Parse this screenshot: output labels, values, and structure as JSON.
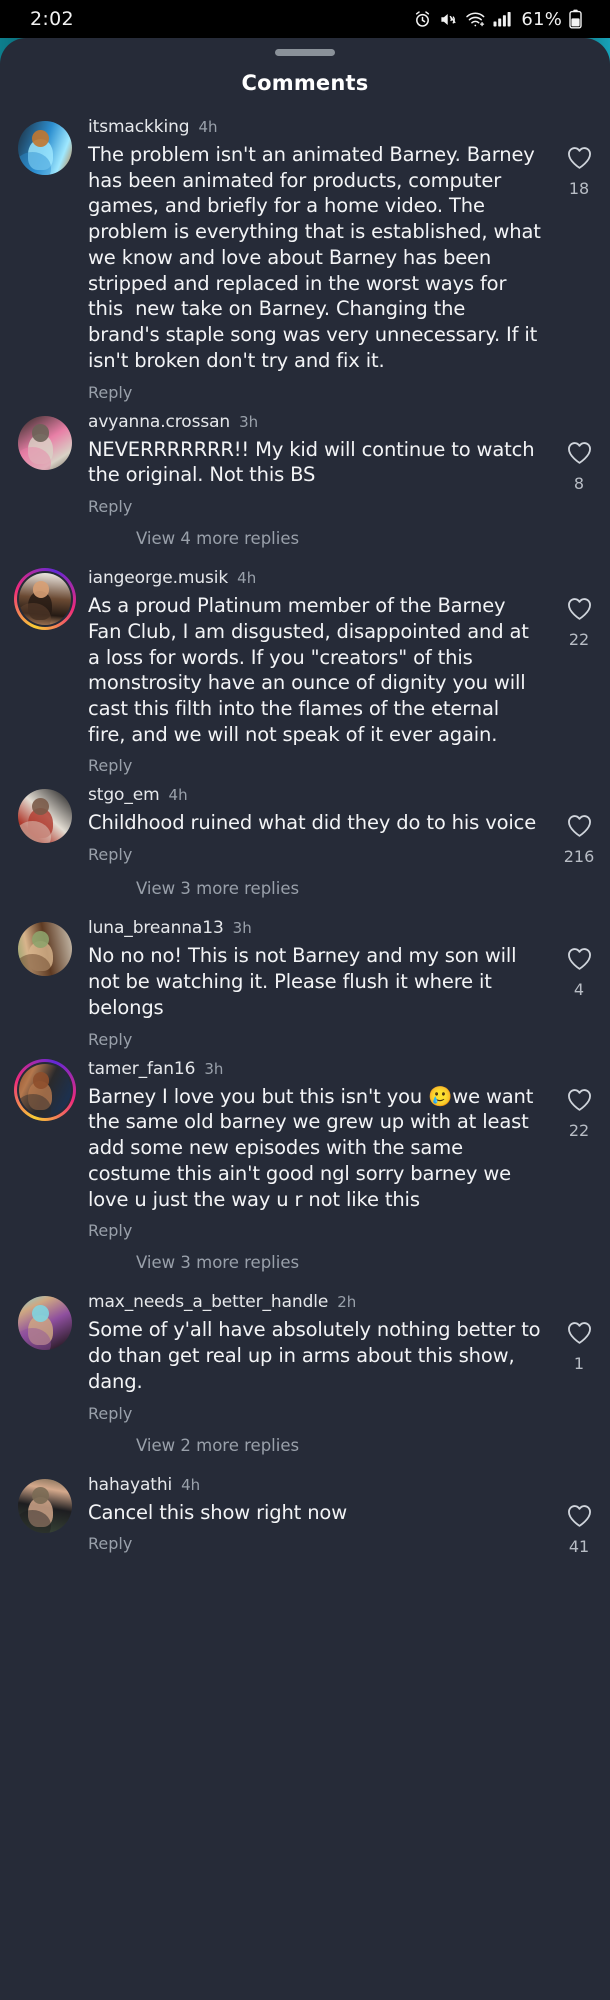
{
  "statusbar": {
    "time": "2:02",
    "battery_text": "61%",
    "icons": [
      "alarm-icon",
      "mute-icon",
      "wifi-icon",
      "cellular-signal-icon",
      "battery-icon"
    ]
  },
  "sheet": {
    "title": "Comments",
    "grabber": "drag-handle",
    "background_color": "#262b38"
  },
  "labels": {
    "reply": "Reply"
  },
  "comments": [
    {
      "username": "itsmackking",
      "timestamp": "4h",
      "text": "The problem isn't an animated Barney. Barney has been animated for products, computer games, and briefly for a home video. The problem is everything that is established, what we know and love about Barney has been stripped and replaced in the worst ways for this  new take on Barney. Changing the brand's staple song was very unnecessary. If it isn't broken don't try and fix it.",
      "reply_label": "Reply",
      "likes": "18",
      "has_story_ring": false,
      "view_replies": null,
      "avatar_colors": [
        "#1b2b3a",
        "#2d8fd0",
        "#9fe8ff",
        "#c2772f"
      ]
    },
    {
      "username": "avyanna.crossan",
      "timestamp": "3h",
      "text": "NEVERRRRRRR!! My kid will continue to watch the original. Not this BS",
      "reply_label": "Reply",
      "likes": "8",
      "has_story_ring": false,
      "view_replies": "View 4 more replies",
      "avatar_colors": [
        "#2a2621",
        "#e87fa6",
        "#d9d2c6",
        "#6b6358"
      ]
    },
    {
      "username": "iangeorge.musik",
      "timestamp": "4h",
      "text": "As a proud Platinum member of the Barney Fan Club, I am disgusted, disappointed and at a loss for words. If you \"creators\" of this monstrosity have an ounce of dignity you will cast this filth into the flames of the eternal fire, and we will not speak of it ever again.",
      "reply_label": "Reply",
      "likes": "22",
      "has_story_ring": true,
      "view_replies": null,
      "avatar_colors": [
        "#f5f2ee",
        "#6b4a33",
        "#241a14",
        "#d8a074"
      ]
    },
    {
      "username": "stgo_em",
      "timestamp": "4h",
      "text": "Childhood ruined what did they do to his voice",
      "reply_label": "Reply",
      "likes": "216",
      "has_story_ring": false,
      "view_replies": "View 3 more replies",
      "avatar_colors": [
        "#0d0d0f",
        "#e3ddd3",
        "#b03a2e",
        "#7a5a48"
      ]
    },
    {
      "username": "luna_breanna13",
      "timestamp": "3h",
      "text": "No no no! This is not Barney and my son will not be watching it. Please flush it where it belongs",
      "reply_label": "Reply",
      "likes": "4",
      "has_story_ring": false,
      "view_replies": null,
      "avatar_colors": [
        "#cfc6b6",
        "#5e3a22",
        "#d8b48c",
        "#8ea36b"
      ]
    },
    {
      "username": "tamer_fan16",
      "timestamp": "3h",
      "text": "Barney I love you but this isn't you 🥲we want the same old barney we grew up with at least add some new episodes with the same costume this ain't good ngl sorry barney we love u just the way u r not like this",
      "reply_label": "Reply",
      "likes": "22",
      "has_story_ring": true,
      "view_replies": "View 3 more replies",
      "avatar_colors": [
        "#16335e",
        "#2a2a2c",
        "#b5784d",
        "#8e4f2c"
      ]
    },
    {
      "username": "max_needs_a_better_handle",
      "timestamp": "2h",
      "text": "Some of y'all have absolutely nothing better to do than get real up in arms about this show, dang.",
      "reply_label": "Reply",
      "likes": "1",
      "has_story_ring": false,
      "view_replies": "View 2 more replies",
      "avatar_colors": [
        "#14100c",
        "#8e4f9e",
        "#cfa882",
        "#7fd4e0"
      ]
    },
    {
      "username": "hahayathi",
      "timestamp": "4h",
      "text": "Cancel this show right now",
      "reply_label": "Reply",
      "likes": "41",
      "has_story_ring": false,
      "view_replies": null,
      "avatar_colors": [
        "#3c4a3a",
        "#1d1d20",
        "#d5a98c",
        "#7a6a54"
      ]
    }
  ]
}
